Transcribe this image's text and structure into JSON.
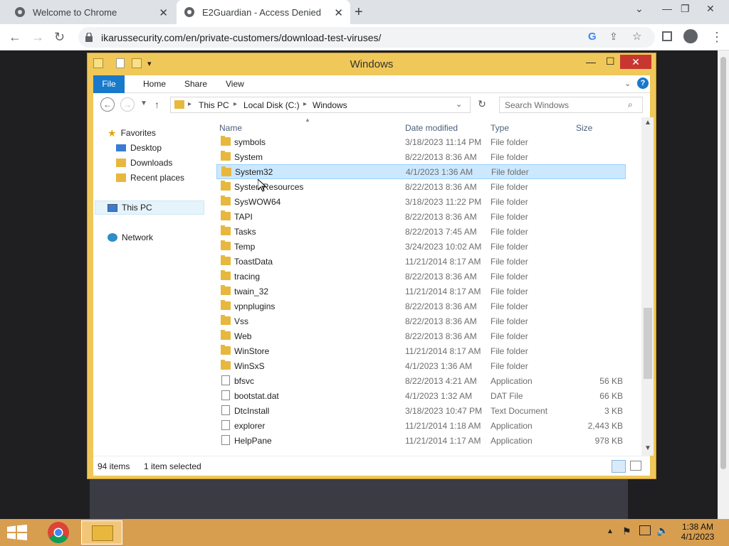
{
  "browser": {
    "tabs": [
      {
        "title": "Welcome to Chrome"
      },
      {
        "title": "E2Guardian - Access Denied"
      }
    ],
    "url": "ikarussecurity.com/en/private-customers/download-test-viruses/"
  },
  "explorer": {
    "title": "Windows",
    "ribbon_tabs": [
      "File",
      "Home",
      "Share",
      "View"
    ],
    "breadcrumb": [
      "This PC",
      "Local Disk (C:)",
      "Windows"
    ],
    "search_placeholder": "Search Windows",
    "nav": {
      "favorites": "Favorites",
      "desktop": "Desktop",
      "downloads": "Downloads",
      "recent": "Recent places",
      "thispc": "This PC",
      "network": "Network"
    },
    "columns": {
      "name": "Name",
      "date": "Date modified",
      "type": "Type",
      "size": "Size"
    },
    "files": [
      {
        "name": "symbols",
        "date": "3/18/2023 11:14 PM",
        "type": "File folder",
        "size": "",
        "kind": "folder"
      },
      {
        "name": "System",
        "date": "8/22/2013 8:36 AM",
        "type": "File folder",
        "size": "",
        "kind": "folder"
      },
      {
        "name": "System32",
        "date": "4/1/2023 1:36 AM",
        "type": "File folder",
        "size": "",
        "kind": "folder",
        "selected": true
      },
      {
        "name": "SystemResources",
        "date": "8/22/2013 8:36 AM",
        "type": "File folder",
        "size": "",
        "kind": "folder"
      },
      {
        "name": "SysWOW64",
        "date": "3/18/2023 11:22 PM",
        "type": "File folder",
        "size": "",
        "kind": "folder"
      },
      {
        "name": "TAPI",
        "date": "8/22/2013 8:36 AM",
        "type": "File folder",
        "size": "",
        "kind": "folder"
      },
      {
        "name": "Tasks",
        "date": "8/22/2013 7:45 AM",
        "type": "File folder",
        "size": "",
        "kind": "folder"
      },
      {
        "name": "Temp",
        "date": "3/24/2023 10:02 AM",
        "type": "File folder",
        "size": "",
        "kind": "folder"
      },
      {
        "name": "ToastData",
        "date": "11/21/2014 8:17 AM",
        "type": "File folder",
        "size": "",
        "kind": "folder"
      },
      {
        "name": "tracing",
        "date": "8/22/2013 8:36 AM",
        "type": "File folder",
        "size": "",
        "kind": "folder"
      },
      {
        "name": "twain_32",
        "date": "11/21/2014 8:17 AM",
        "type": "File folder",
        "size": "",
        "kind": "folder"
      },
      {
        "name": "vpnplugins",
        "date": "8/22/2013 8:36 AM",
        "type": "File folder",
        "size": "",
        "kind": "folder"
      },
      {
        "name": "Vss",
        "date": "8/22/2013 8:36 AM",
        "type": "File folder",
        "size": "",
        "kind": "folder"
      },
      {
        "name": "Web",
        "date": "8/22/2013 8:36 AM",
        "type": "File folder",
        "size": "",
        "kind": "folder"
      },
      {
        "name": "WinStore",
        "date": "11/21/2014 8:17 AM",
        "type": "File folder",
        "size": "",
        "kind": "folder"
      },
      {
        "name": "WinSxS",
        "date": "4/1/2023 1:36 AM",
        "type": "File folder",
        "size": "",
        "kind": "folder"
      },
      {
        "name": "bfsvc",
        "date": "8/22/2013 4:21 AM",
        "type": "Application",
        "size": "56 KB",
        "kind": "file"
      },
      {
        "name": "bootstat.dat",
        "date": "4/1/2023 1:32 AM",
        "type": "DAT File",
        "size": "66 KB",
        "kind": "file"
      },
      {
        "name": "DtcInstall",
        "date": "3/18/2023 10:47 PM",
        "type": "Text Document",
        "size": "3 KB",
        "kind": "file"
      },
      {
        "name": "explorer",
        "date": "11/21/2014 1:18 AM",
        "type": "Application",
        "size": "2,443 KB",
        "kind": "file"
      },
      {
        "name": "HelpPane",
        "date": "11/21/2014 1:17 AM",
        "type": "Application",
        "size": "978 KB",
        "kind": "file"
      }
    ],
    "status_items": "94 items",
    "status_selected": "1 item selected"
  },
  "taskbar": {
    "time": "1:38 AM",
    "date": "4/1/2023"
  }
}
